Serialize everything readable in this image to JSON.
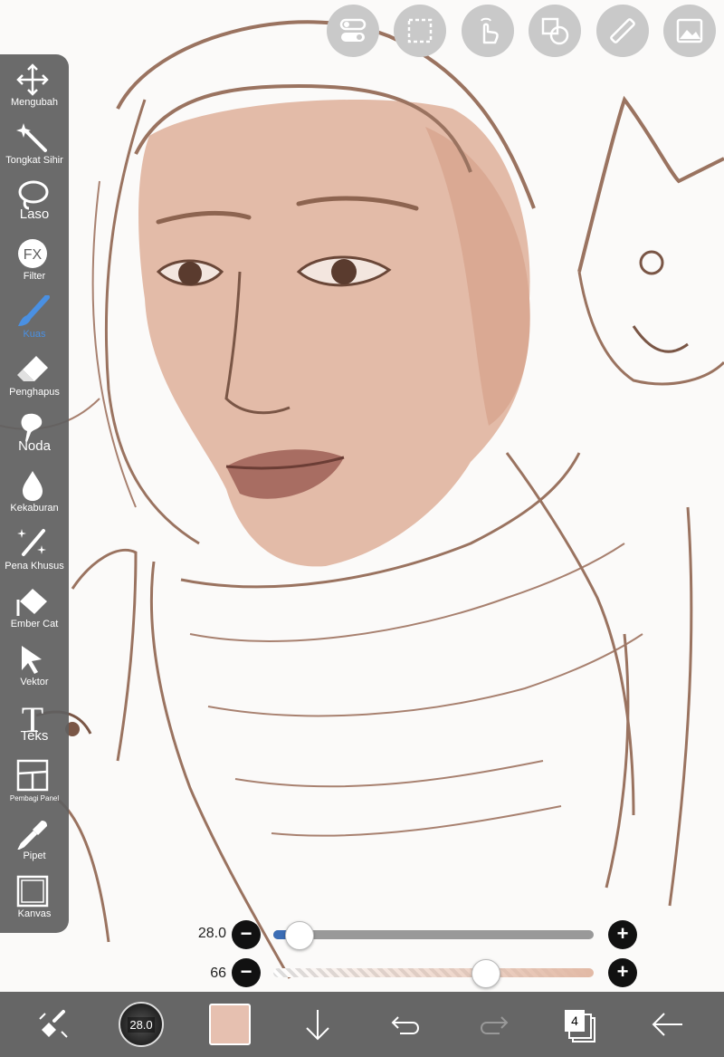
{
  "tools": [
    {
      "name": "tool-transform",
      "icon": "move-arrows-icon",
      "label": "Mengubah"
    },
    {
      "name": "tool-magic-wand",
      "icon": "magic-wand-icon",
      "label": "Tongkat Sihir"
    },
    {
      "name": "tool-lasso",
      "icon": "lasso-icon",
      "label": "Laso"
    },
    {
      "name": "tool-filter",
      "icon": "fx-icon",
      "label": "Filter"
    },
    {
      "name": "tool-brush",
      "icon": "brush-icon",
      "label": "Kuas"
    },
    {
      "name": "tool-eraser",
      "icon": "eraser-icon",
      "label": "Penghapus"
    },
    {
      "name": "tool-smudge",
      "icon": "smudge-icon",
      "label": "Noda"
    },
    {
      "name": "tool-blur",
      "icon": "droplet-icon",
      "label": "Kekaburan"
    },
    {
      "name": "tool-special-pen",
      "icon": "sparkle-pen-icon",
      "label": "Pena Khusus"
    },
    {
      "name": "tool-bucket",
      "icon": "paint-bucket-icon",
      "label": "Ember Cat"
    },
    {
      "name": "tool-vector",
      "icon": "cursor-arrow-icon",
      "label": "Vektor"
    },
    {
      "name": "tool-text",
      "icon": "text-t-icon",
      "label": "Teks"
    },
    {
      "name": "tool-panel-divider",
      "icon": "panel-divider-icon",
      "label": "Pembagi Panel"
    },
    {
      "name": "tool-eyedropper",
      "icon": "eyedropper-icon",
      "label": "Pipet"
    },
    {
      "name": "tool-canvas",
      "icon": "canvas-square-icon",
      "label": "Kanvas"
    }
  ],
  "active_tool": "Kuas",
  "top_buttons": [
    "toggle-icon",
    "selection-icon",
    "touch-hand-icon",
    "shape-overlay-icon",
    "ruler-icon",
    "image-icon"
  ],
  "brush_size": {
    "value": "28.0",
    "level": 0.08
  },
  "opacity": {
    "value": "66",
    "level": 0.66
  },
  "bottom": {
    "brush_preview_label": "28.0",
    "current_color": "#e6c0b0",
    "layer_count": "4"
  },
  "colors": {
    "accent": "#4a90e2",
    "slider_fill": "#3b6db5",
    "sketch": "#9a7360",
    "skin": "#e2b9a5"
  }
}
